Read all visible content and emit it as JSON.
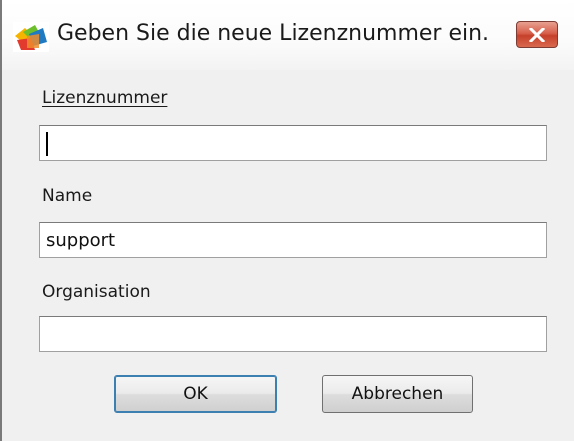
{
  "window": {
    "title": "Geben Sie die neue Lizenznummer ein.",
    "close_symbol": "✕"
  },
  "form": {
    "license": {
      "label": "Lizenznummer",
      "value": ""
    },
    "name": {
      "label": "Name",
      "value": "support"
    },
    "organisation": {
      "label": "Organisation",
      "value": ""
    }
  },
  "buttons": {
    "ok_label": "OK",
    "cancel_label": "Abbrechen"
  },
  "icons": {
    "app": "avg-logo-icon",
    "close": "close-icon"
  },
  "colors": {
    "close_button": "#d7604c",
    "window_background": "#f0f0f0"
  }
}
